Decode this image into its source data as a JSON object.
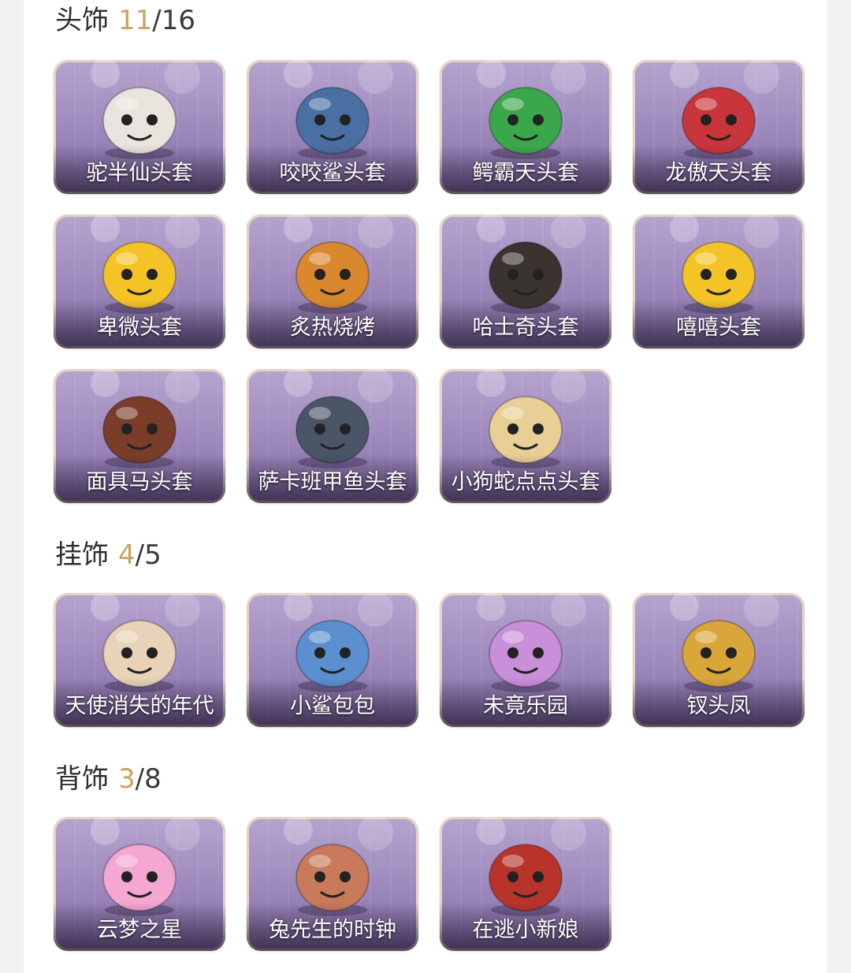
{
  "sections": [
    {
      "name": "头饰",
      "owned": "11",
      "total": "/16",
      "items": [
        {
          "label": "驼半仙头套",
          "icon": "alpaca-sunglasses-head-icon",
          "color": "#e9e4de"
        },
        {
          "label": "咬咬鲨头套",
          "icon": "shark-head-icon",
          "color": "#4a6fa3"
        },
        {
          "label": "鳄霸天头套",
          "icon": "crocodile-head-icon",
          "color": "#3aa84a"
        },
        {
          "label": "龙傲天头套",
          "icon": "dragon-head-icon",
          "color": "#c8353a"
        },
        {
          "label": "卑微头套",
          "icon": "sad-emoji-head-icon",
          "color": "#f4c326"
        },
        {
          "label": "炙热烧烤",
          "icon": "bbq-meat-head-icon",
          "color": "#d9882e"
        },
        {
          "label": "哈士奇头套",
          "icon": "husky-sunglasses-head-icon",
          "color": "#3b3330"
        },
        {
          "label": "嘻嘻头套",
          "icon": "grin-emoji-head-icon",
          "color": "#f4c326"
        },
        {
          "label": "面具马头套",
          "icon": "horse-mask-head-icon",
          "color": "#7a3d2a"
        },
        {
          "label": "萨卡班甲鱼头套",
          "icon": "fish-head-icon",
          "color": "#4b5568"
        },
        {
          "label": "小狗蛇点点头套",
          "icon": "snake-head-icon",
          "color": "#e8cf96"
        }
      ]
    },
    {
      "name": "挂饰",
      "owned": "4",
      "total": "/5",
      "items": [
        {
          "label": "天使消失的年代",
          "icon": "angel-girl-pendant-icon",
          "color": "#e8d3b8"
        },
        {
          "label": "小鲨包包",
          "icon": "shark-bag-pendant-icon",
          "color": "#5b8fcf"
        },
        {
          "label": "未竟乐园",
          "icon": "doll-girl-pendant-icon",
          "color": "#c98fd8"
        },
        {
          "label": "钗头凤",
          "icon": "phoenix-crown-pendant-icon",
          "color": "#d9a63a"
        }
      ]
    },
    {
      "name": "背饰",
      "owned": "3",
      "total": "/8",
      "items": [
        {
          "label": "云梦之星",
          "icon": "unicorn-star-back-icon",
          "color": "#f4a7d0"
        },
        {
          "label": "兔先生的时钟",
          "icon": "rabbit-clock-back-icon",
          "color": "#c97a5a"
        },
        {
          "label": "在逃小新娘",
          "icon": "red-veil-back-icon",
          "color": "#b8342a"
        }
      ]
    }
  ]
}
